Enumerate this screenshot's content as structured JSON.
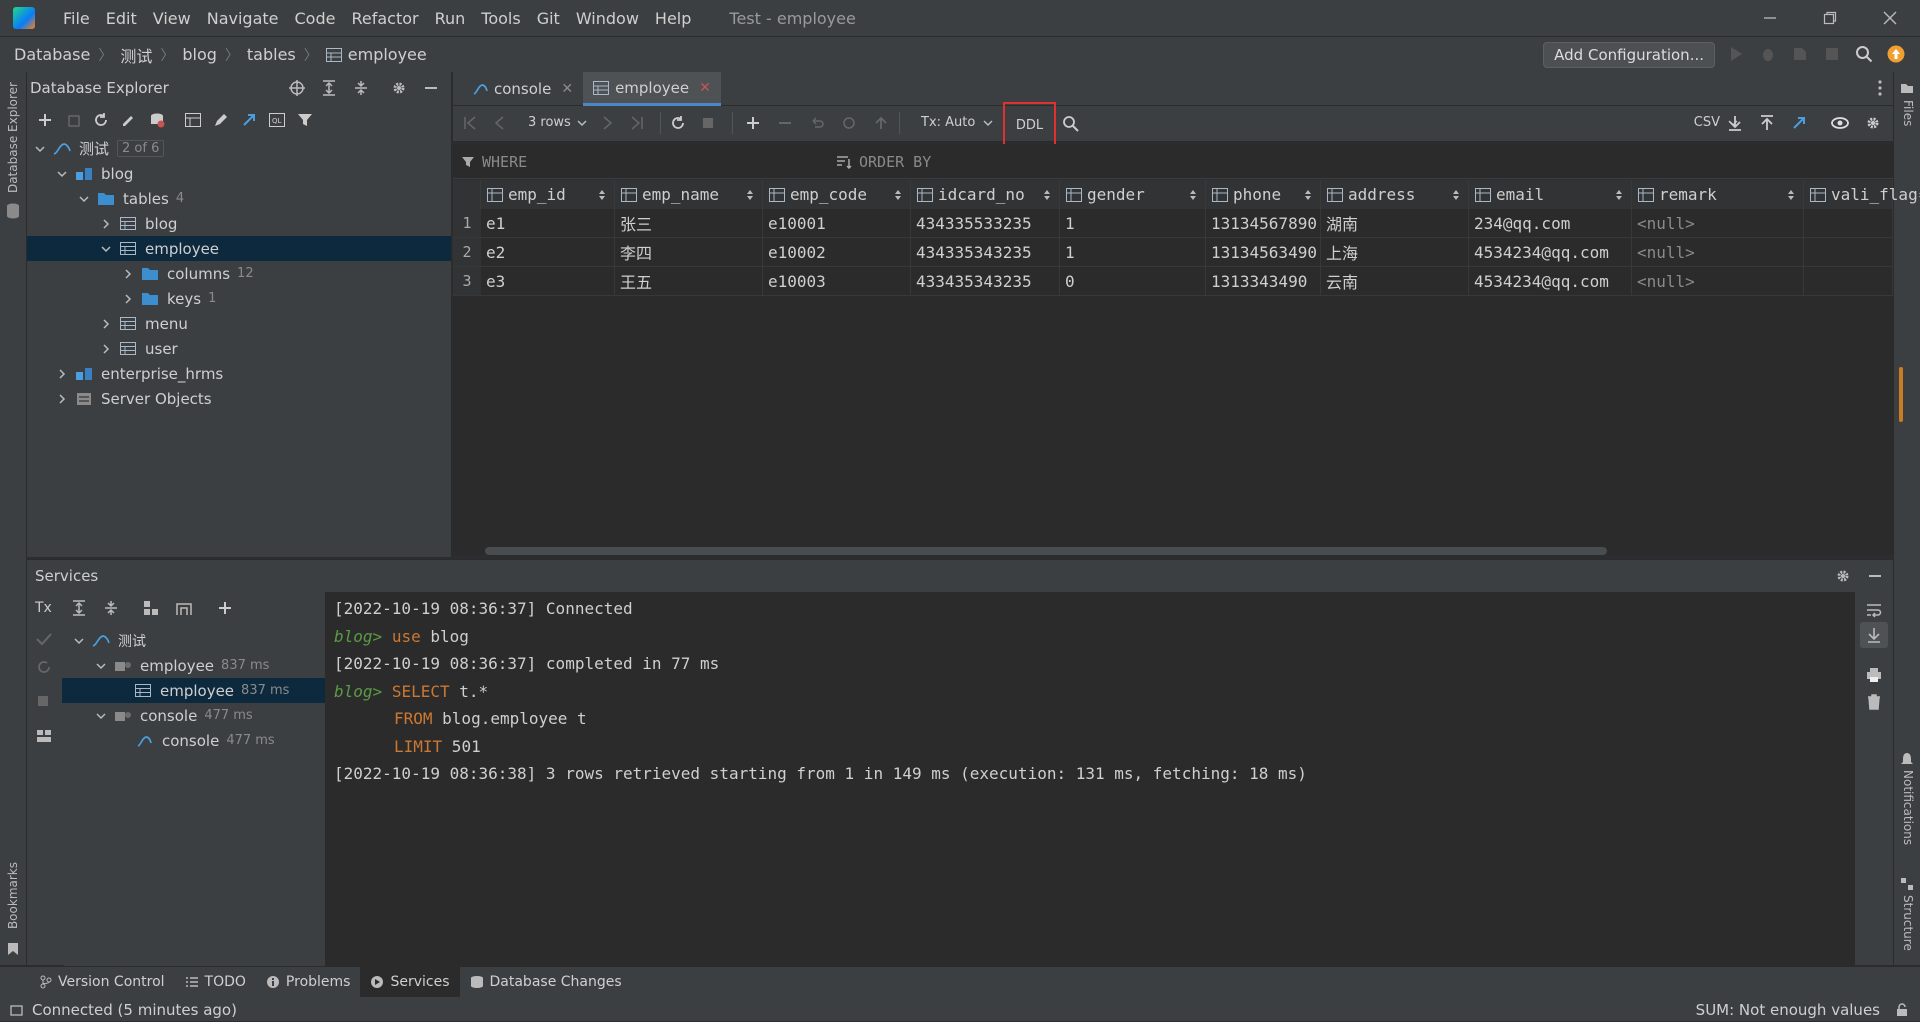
{
  "window": {
    "title": "Test - employee",
    "menu": [
      "File",
      "Edit",
      "View",
      "Navigate",
      "Code",
      "Refactor",
      "Run",
      "Tools",
      "Git",
      "Window",
      "Help"
    ]
  },
  "breadcrumb": [
    "Database",
    "测试",
    "blog",
    "tables",
    "employee"
  ],
  "toolbar": {
    "add_configuration": "Add Configuration..."
  },
  "left_strip": {
    "database_explorer": "Database Explorer",
    "bookmarks": "Bookmarks"
  },
  "right_strip": {
    "files": "Files",
    "notifications": "Notifications",
    "structure": "Structure"
  },
  "db_explorer": {
    "title": "Database Explorer",
    "tree": {
      "root": {
        "label": "测试",
        "badge": "2 of 6"
      },
      "blog": "blog",
      "tables": {
        "label": "tables",
        "count": "4"
      },
      "t_blog": "blog",
      "t_employee": "employee",
      "columns": {
        "label": "columns",
        "count": "12"
      },
      "keys": {
        "label": "keys",
        "count": "1"
      },
      "t_menu": "menu",
      "t_user": "user",
      "enterprise": "enterprise_hrms",
      "server": "Server Objects"
    }
  },
  "editor": {
    "tabs": [
      {
        "label": "console",
        "active": false
      },
      {
        "label": "employee",
        "active": true
      }
    ],
    "grid_toolbar": {
      "rows": "3 rows",
      "tx": "Tx: Auto",
      "ddl": "DDL",
      "export": "CSV"
    },
    "filter": {
      "where": "WHERE",
      "order_by": "ORDER BY"
    },
    "columns": [
      "emp_id",
      "emp_name",
      "emp_code",
      "idcard_no",
      "gender",
      "phone",
      "address",
      "email",
      "remark",
      "vali_flag"
    ],
    "rows": [
      {
        "n": "1",
        "cells": [
          "e1",
          "张三",
          "e10001",
          "434335533235",
          "1",
          "13134567890",
          "湖南",
          "234@qq.com",
          "<null>",
          ""
        ]
      },
      {
        "n": "2",
        "cells": [
          "e2",
          "李四",
          "e10002",
          "434335343235",
          "1",
          "13134563490",
          "上海",
          "4534234@qq.com",
          "<null>",
          ""
        ]
      },
      {
        "n": "3",
        "cells": [
          "e3",
          "王五",
          "e10003",
          "433435343235",
          "0",
          "1313343490",
          "云南",
          "4534234@qq.com",
          "<null>",
          ""
        ]
      }
    ]
  },
  "services": {
    "title": "Services",
    "tree": {
      "root": "测试",
      "employee_session": {
        "label": "employee",
        "time": "837 ms"
      },
      "employee_item": {
        "label": "employee",
        "time": "837 ms"
      },
      "console_session": {
        "label": "console",
        "time": "477 ms"
      },
      "console_item": {
        "label": "console",
        "time": "477 ms"
      }
    },
    "console": {
      "l1": "[2022-10-19 08:36:37] Connected",
      "prompt": "blog>",
      "l2_kw": "use",
      "l2_rest": " blog",
      "l3": "[2022-10-19 08:36:37] completed in 77 ms",
      "l4_kw": "SELECT",
      "l4_rest": " t.*",
      "l5_kw": "FROM",
      "l5_rest": " blog.employee t",
      "l6_kw": "LIMIT",
      "l6_rest": " 501",
      "l7": "[2022-10-19 08:36:38] 3 rows retrieved starting from 1 in 149 ms (execution: 131 ms, fetching: 18 ms)"
    }
  },
  "bottom_tabs": [
    "Version Control",
    "TODO",
    "Problems",
    "Services",
    "Database Changes"
  ],
  "status": {
    "left": "Connected (5 minutes ago)",
    "right": "SUM: Not enough values"
  },
  "colors": {
    "highlight_box": "#e03030",
    "accent": "#4a88c7",
    "keyword": "#cc7832",
    "prompt": "#5b9b45"
  }
}
